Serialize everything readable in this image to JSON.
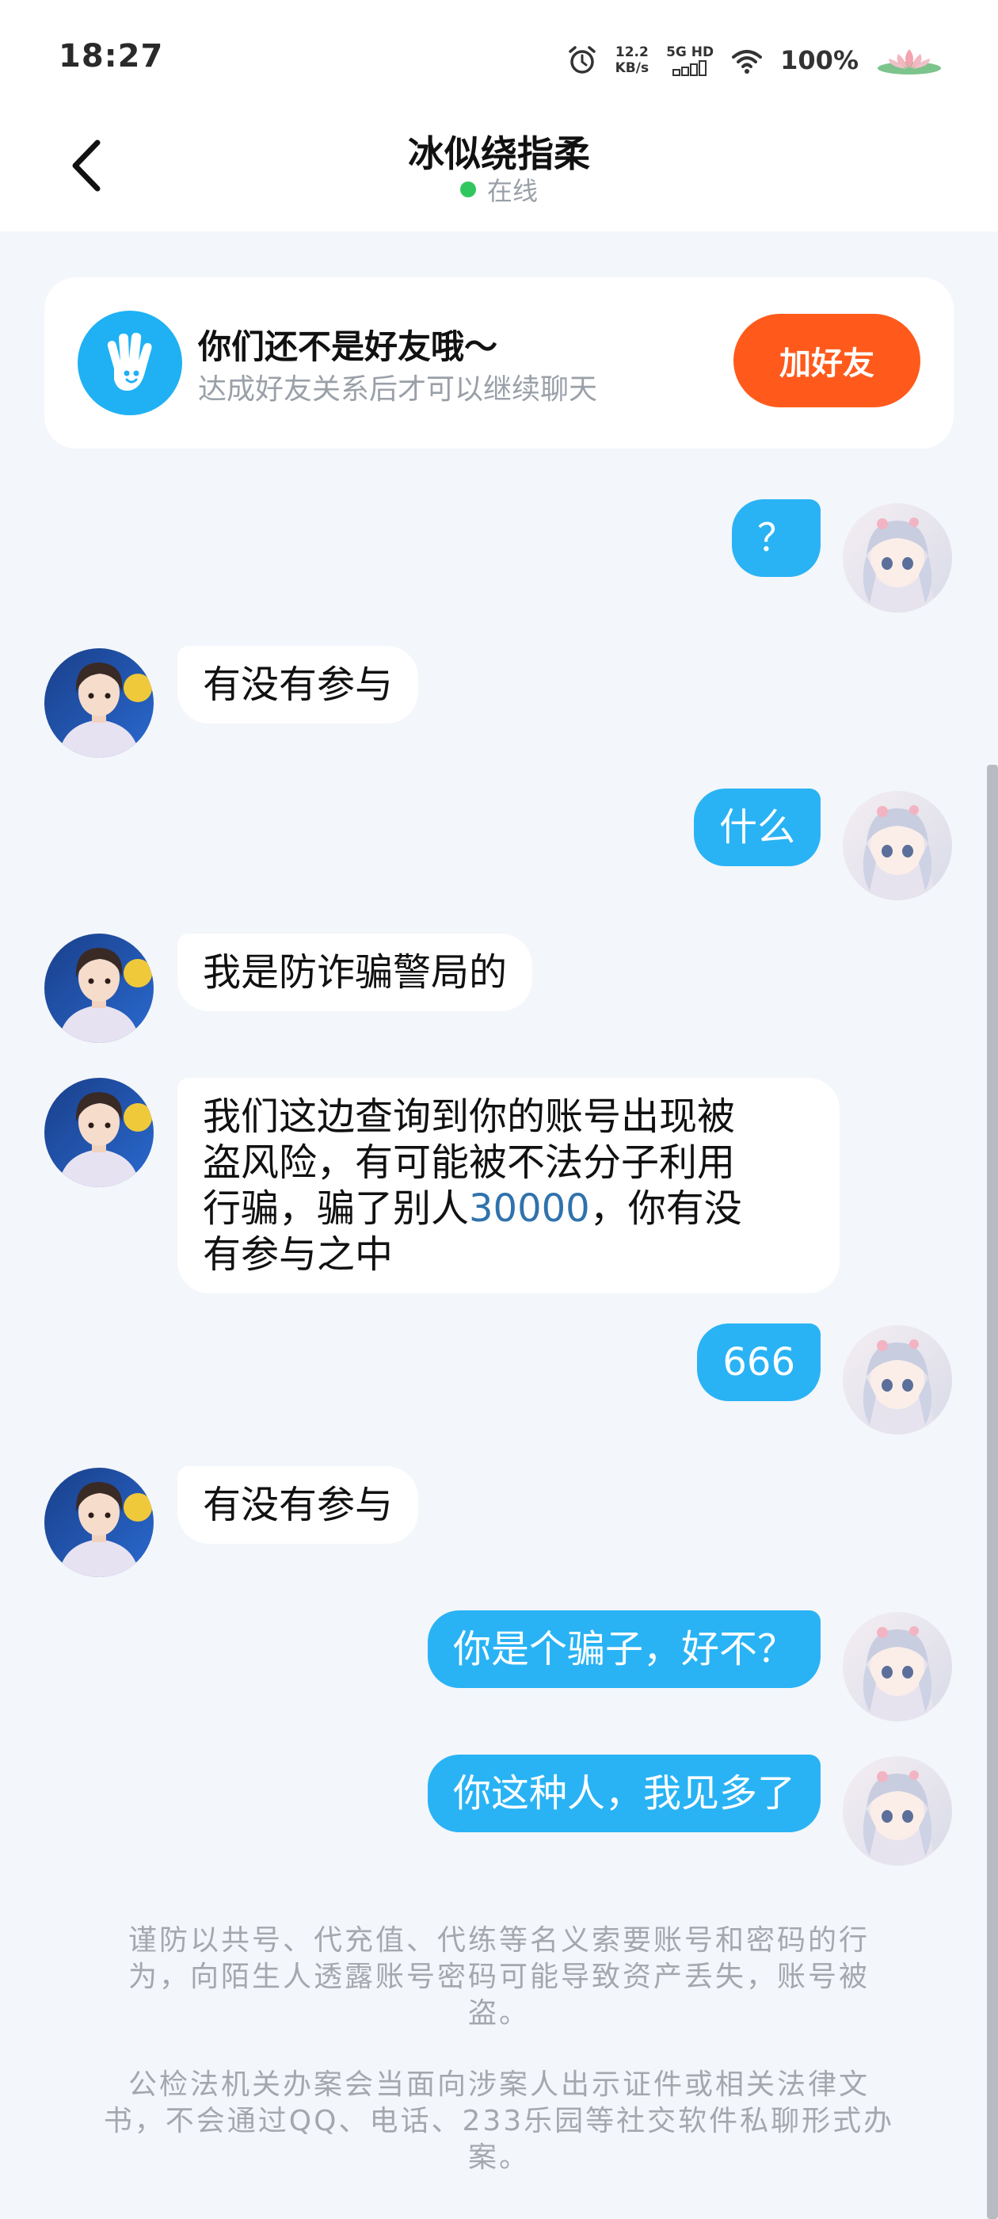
{
  "status_bar": {
    "time": "18:27",
    "net_speed_value": "12.2",
    "net_speed_unit": "KB/s",
    "network": "5G HD",
    "battery": "100%",
    "icons": [
      "alarm-icon",
      "signal-icon",
      "wifi-icon",
      "lotus-icon"
    ]
  },
  "header": {
    "title": "冰似绕指柔",
    "status": "在线",
    "status_color": "#30c85e"
  },
  "friend_banner": {
    "title": "你们还不是好友哦～",
    "subtitle": "达成好友关系后才可以继续聊天",
    "button": "加好友",
    "button_color": "#ff5a1c",
    "icon": "waving-hand-icon"
  },
  "messages": [
    {
      "side": "out",
      "text": "？"
    },
    {
      "side": "in",
      "text": "有没有参与"
    },
    {
      "side": "out",
      "text": "什么"
    },
    {
      "side": "in",
      "text": "我是防诈骗警局的"
    },
    {
      "side": "in",
      "line1": "我们这边查询到你的账号出现被",
      "line2": "盗风险，有可能被不法分子利用",
      "line3a": "行骗，骗了别人",
      "line3num": "30000",
      "line3b": "，你有没",
      "line4": "有参与之中"
    },
    {
      "side": "out",
      "text": "666"
    },
    {
      "side": "in",
      "text": "有没有参与"
    },
    {
      "side": "out",
      "text": "你是个骗子，好不？"
    },
    {
      "side": "out",
      "text": "你这种人，我见多了"
    }
  ],
  "notice": {
    "p1_l1": "谨防以共号、代充值、代练等名义索要账号和密码的行",
    "p1_l2": "为，向陌生人透露账号密码可能导致资产丢失，账号被",
    "p1_l3": "盗。",
    "p2_l1": "公检法机关办案会当面向涉案人出示证件或相关法律文",
    "p2_l2": "书，不会通过QQ、电话、233乐园等社交软件私聊形式办",
    "p2_l3": "案。"
  },
  "colors": {
    "outgoing_bubble": "#29b3f5",
    "incoming_bubble": "#ffffff",
    "background": "#f3f6fa"
  }
}
